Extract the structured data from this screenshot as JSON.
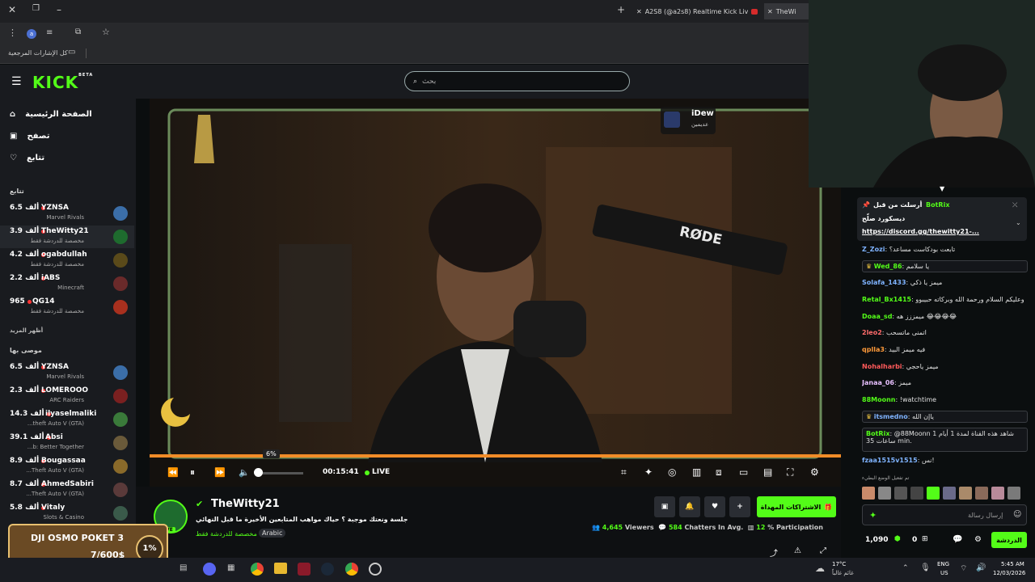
{
  "browser": {
    "tabs": [
      {
        "label": "A2S8 (@a2s8) Realtime Kick Liv",
        "recording": true
      },
      {
        "label": "TheWi"
      }
    ],
    "bookmarks_label": "كل الإشارات المرجعية",
    "avatar_letter": "a"
  },
  "kick": {
    "logo": "KICK",
    "logo_badge": "BETA",
    "search_placeholder": "بحث"
  },
  "sidebar": {
    "nav": [
      {
        "label": "الصفحة الرئيسية",
        "icon": "home-icon"
      },
      {
        "label": "تصفح",
        "icon": "browse-icon"
      },
      {
        "label": "تتابع",
        "icon": "heart-icon"
      }
    ],
    "following_title": "تتابع",
    "following": [
      {
        "name": "YZNSA",
        "viewers": "6.5 ألف",
        "category": "Marvel Rivals",
        "color": "#3b6ea8"
      },
      {
        "name": "TheWitty21",
        "viewers": "3.9 ألف",
        "category": "مخصصة للدردشة فقط",
        "color": "#1e6b2e",
        "active": true
      },
      {
        "name": "ogabdullah",
        "viewers": "4.2 ألف",
        "category": "مخصصة للدردشة فقط",
        "color": "#5a4a1a"
      },
      {
        "name": "iABS",
        "viewers": "2.2 ألف",
        "category": "Minecraft",
        "color": "#6a2a2a"
      },
      {
        "name": "QG14",
        "viewers": "965",
        "category": "مخصصة للدردشة فقط",
        "color": "#a8301e"
      }
    ],
    "show_more": "أظهر المزيد",
    "recommended_title": "موصى بها",
    "recommended": [
      {
        "name": "YZNSA",
        "viewers": "6.5 ألف",
        "category": "Marvel Rivals",
        "color": "#3b6ea8"
      },
      {
        "name": "LOMEROOO",
        "viewers": "2.3 ألف",
        "category": "ARC Raiders",
        "color": "#7a2020"
      },
      {
        "name": "ilyaselmaliki",
        "viewers": "14.3 ألف",
        "category": "...theft Auto V (GTA)",
        "color": "#3a7a3a"
      },
      {
        "name": "Absi",
        "viewers": "39.1 ألف",
        "category": "...b: Better Together",
        "color": "#6a5a3a"
      },
      {
        "name": "Bougassaa",
        "viewers": "8.9 ألف",
        "category": "...Theft Auto V (GTA)",
        "color": "#8a6a2a"
      },
      {
        "name": "AhmedSabiri",
        "viewers": "8.7 ألف",
        "category": "...Theft Auto V (GTA)",
        "color": "#5a3a3a"
      },
      {
        "name": "Vitaly",
        "viewers": "5.8 ألف",
        "category": "Slots & Casino",
        "color": "#3a5a4a"
      }
    ]
  },
  "goal": {
    "title": "DJI OSMO POKET 3",
    "progress_text": "7/600$",
    "percent_label": "1%"
  },
  "player": {
    "volume_tooltip": "6%",
    "volume": 0.06,
    "progress": 1.0,
    "time": "00:15:41",
    "live_label": "LIVE",
    "overlay_channel": "iDew",
    "overlay_sub": "عديمين",
    "mic_brand": "RØDE"
  },
  "stream": {
    "channel": "TheWitty21",
    "title": "جلسة ونعتك موجبة ؟ حياك مواهب المتابعين الأخيرة ما قبل النهائي",
    "category": "مخصصة للدردشة فقط",
    "tag": "Arabic",
    "live_badge": "LIVE",
    "subscribe_label": "الاشتراكات المهداة",
    "stats": {
      "viewers_count": "4,645",
      "viewers_label": "Viewers",
      "chatters_count": "584",
      "chatters_label": "Chatters In Avg.",
      "participation_count": "12",
      "participation_label": "% Participation"
    }
  },
  "chat": {
    "pinned": {
      "header": "أرسلت من قبل",
      "user": "BotRix",
      "line1": "ديسكورد صلّح",
      "link": "https://discord.gg/thewitty21-..."
    },
    "messages": [
      {
        "user": "Z_Zozi",
        "text": "تابعت بودكاست مساعد؟",
        "color": "#7fb3ff"
      },
      {
        "user": "Wed_86",
        "text": "يا سلامم",
        "color": "#53fc18",
        "boxed": true
      },
      {
        "user": "Solafa_1433",
        "text": "ميمز يا ذكي",
        "color": "#7fb3ff"
      },
      {
        "user": "Retal_Bx1415",
        "text": "وعليكم السلام ورحمة الله وبركاته حبيبوو",
        "color": "#53fc18"
      },
      {
        "user": "Doaa_sd",
        "text": "ميمززز هه 😂😂😂😂",
        "color": "#53fc18"
      },
      {
        "user": "2leo2",
        "text": "اتمنى ماتسحب",
        "color": "#ff6b6b"
      },
      {
        "user": "qplla3",
        "text": "فيه ميمز البيد",
        "color": "#ff9a3a"
      },
      {
        "user": "Nohalharbi",
        "text": "ميمز ياحجي",
        "color": "#ff5a5a"
      },
      {
        "user": "Janaa_06",
        "text": "ميمز",
        "color": "#e8c0ff"
      },
      {
        "user": "88Moonn",
        "text": "!watchtime",
        "color": "#53fc18"
      },
      {
        "user": "itsmedno",
        "text": "ياإن الله",
        "color": "#7fb3ff",
        "boxed": true
      },
      {
        "user": "BotRix",
        "text": "@88Moonn شاهد هذه القناة لمدة 1 أيام 1 ساعات 35 min.",
        "color": "#53fc18",
        "boxed": true
      },
      {
        "user": "fzaa1515v1515",
        "text": "نس!",
        "color": "#7fb3ff"
      }
    ],
    "emote_mode_label": "تم تفعيل الوضع البطيء",
    "input_placeholder": "إرسال رسالة",
    "points": "1,090",
    "gifts": "0",
    "send_label": "الدردشة"
  },
  "taskbar": {
    "weather_temp": "17°C",
    "weather_desc": "غائم غالباً",
    "lang": "ENG",
    "region": "US",
    "time": "5:45 AM",
    "date": "12/03/2026"
  }
}
